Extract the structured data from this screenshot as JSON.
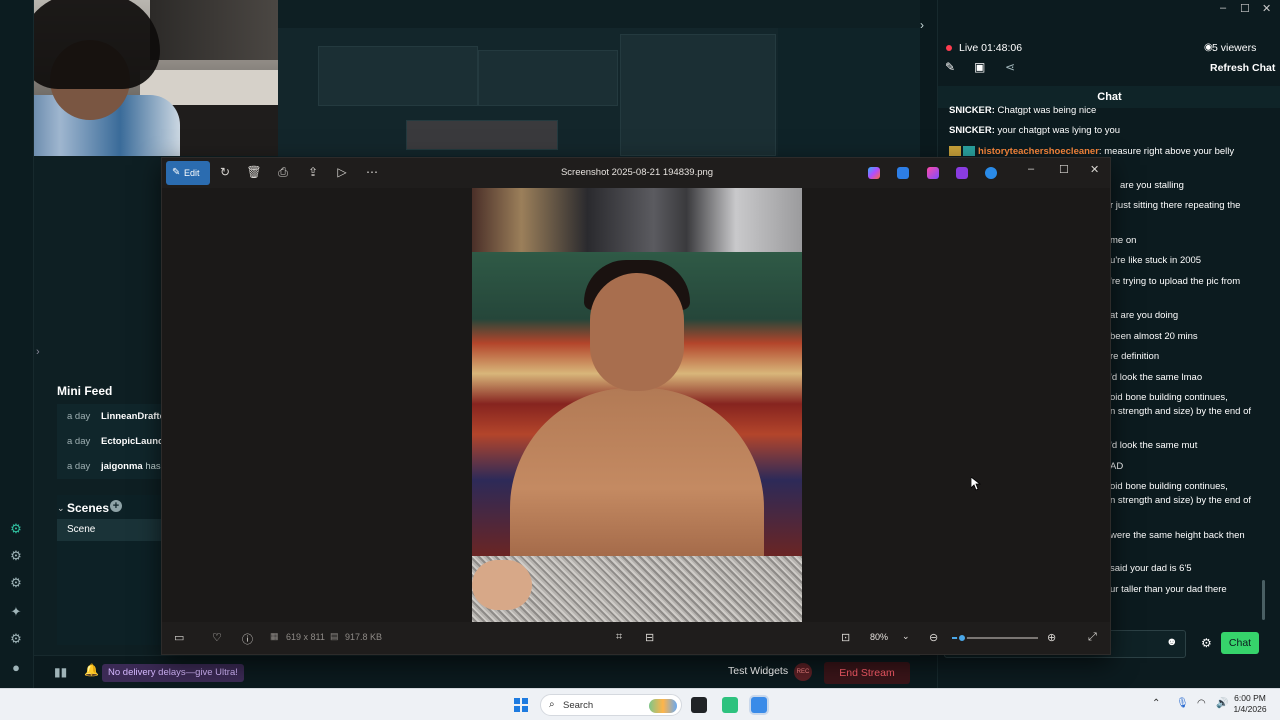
{
  "stream": {
    "live_text": "Live 01:48:06",
    "viewers": "5 viewers",
    "refresh_chat": "Refresh Chat",
    "chat_title": "Chat",
    "chat_button": "Chat"
  },
  "chat": [
    {
      "user": "SNICKER:",
      "text": " Chatgpt was being nice"
    },
    {
      "user": "SNICKER:",
      "text": " your chatgpt was lying to you"
    },
    {
      "user": "historyteachershoecleaner",
      "text": ": measure right above your belly",
      "orange": true
    },
    {
      "text": "are you stalling"
    },
    {
      "text": "r just sitting there repeating the"
    },
    {
      "text": "me on"
    },
    {
      "text": "you're like stuck in 2005"
    },
    {
      "text": "'re trying to upload the pic from"
    },
    {
      "text": "at are you doing"
    },
    {
      "text": "been almost 20 mins"
    },
    {
      "text": "re definition"
    },
    {
      "text": "'d look the same lmao"
    },
    {
      "text": "oid bone building continues,"
    },
    {
      "text": "n strength and size) by the end of"
    },
    {
      "text": "'d look the same mut"
    },
    {
      "text": "AD"
    },
    {
      "text": "oid bone building continues,"
    },
    {
      "text": "n strength and size) by the end of"
    },
    {
      "text": "were the same height back then"
    },
    {
      "text": "said your dad is 6'5"
    },
    {
      "text": "ur taller than your dad there"
    }
  ],
  "mini_feed": {
    "title": "Mini Feed",
    "items": [
      {
        "when": "a day",
        "who": "LinneanDrafter"
      },
      {
        "when": "a day",
        "who": "EctopicLaunch"
      },
      {
        "when": "a day",
        "who": "jaigonma",
        "rest": " has"
      }
    ]
  },
  "scenes": {
    "title": "Scenes",
    "items": [
      "Scene"
    ]
  },
  "bottom_bar": {
    "promo": "No delivery delays—give Ultra!",
    "test_widgets": "Test Widgets",
    "rec_badge": "REC",
    "end_stream": "End Stream"
  },
  "photos": {
    "edit_label": "Edit",
    "title": "Screenshot 2025-08-21 194839.png",
    "dimensions": "619 x 811",
    "size": "917.8 KB",
    "zoom": "80%",
    "zoom_level": 0.12
  },
  "taskbar": {
    "search_placeholder": "Search",
    "time": "6:00 PM",
    "date": "1/4/2026"
  },
  "colors": {
    "accent_green": "#36d36b",
    "live_red": "#ff3c4f",
    "end_stream_red": "#ff5e6b",
    "photos_blue": "#2b6cb0",
    "username_orange": "#ff8a3d"
  }
}
